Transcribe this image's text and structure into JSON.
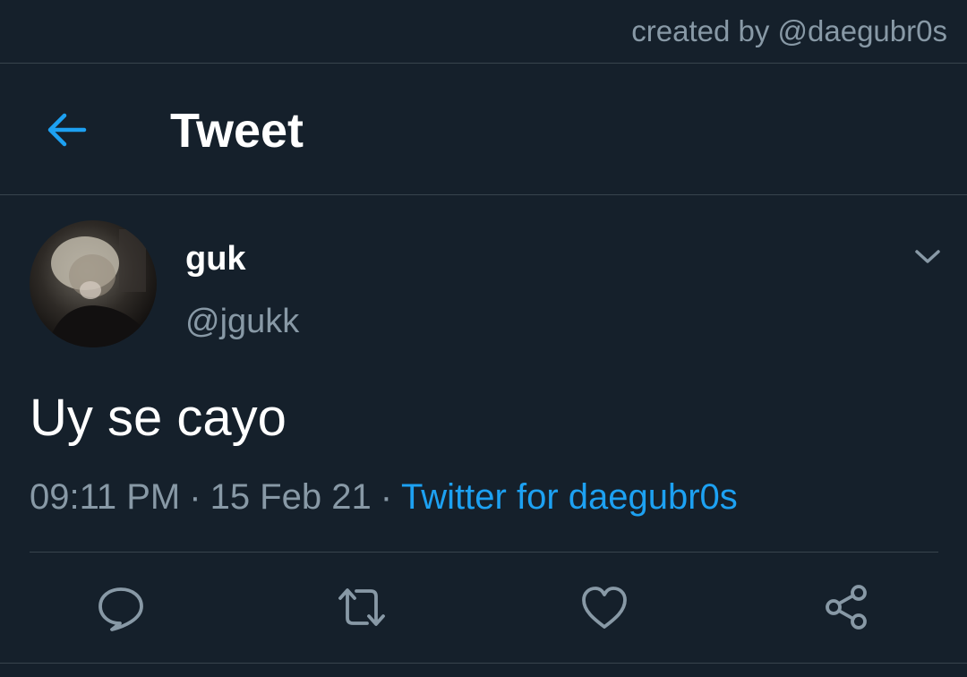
{
  "credit": "created by @daegubr0s",
  "header": {
    "title": "Tweet",
    "back_icon": "arrow-left-icon"
  },
  "tweet": {
    "display_name": "guk",
    "handle": "@jgukk",
    "text": "Uy se cayo",
    "time": "09:11 PM",
    "separator": "·",
    "date": "15 Feb 21",
    "source": "Twitter for daegubr0s",
    "avatar": "user-avatar-photo",
    "more_icon": "chevron-down-icon"
  },
  "actions": [
    {
      "name": "reply",
      "icon": "reply-icon"
    },
    {
      "name": "retweet",
      "icon": "retweet-icon"
    },
    {
      "name": "like",
      "icon": "heart-icon"
    },
    {
      "name": "share",
      "icon": "share-icon"
    }
  ],
  "colors": {
    "background": "#15202b",
    "accent": "#1da1f2",
    "muted_text": "#8899a6",
    "divider": "#38444d",
    "primary_text": "#ffffff"
  }
}
